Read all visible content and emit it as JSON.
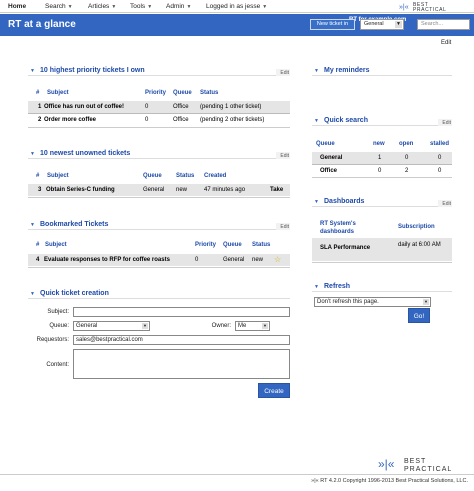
{
  "topnav": {
    "items": [
      {
        "label": "Home",
        "arrow": ""
      },
      {
        "label": "Search",
        "arrow": "▼"
      },
      {
        "label": "Articles",
        "arrow": "▼"
      },
      {
        "label": "Tools",
        "arrow": "▼"
      },
      {
        "label": "Admin",
        "arrow": "▼"
      },
      {
        "label": "Logged in as jesse",
        "arrow": "▼"
      }
    ]
  },
  "brand": {
    "name": "BEST PRACTICAL",
    "mark": "»|«"
  },
  "header": {
    "title": "RT at a glance",
    "rt_for": "RT for example.com",
    "new_ticket_label": "New ticket in",
    "queue_value": "General",
    "search_placeholder": "Search..."
  },
  "page_edit": "Edit",
  "priority_box": {
    "title": "10 highest priority tickets I own",
    "edit": "Edit",
    "columns": [
      "#",
      "Subject",
      "Priority",
      "Queue",
      "Status"
    ],
    "rows": [
      {
        "id": "1",
        "subject": "Office has run out of coffee!",
        "priority": "0",
        "queue": "Office",
        "status": "(pending 1 other ticket)"
      },
      {
        "id": "2",
        "subject": "Order more coffee",
        "priority": "0",
        "queue": "Office",
        "status": "(pending 2 other tickets)"
      }
    ]
  },
  "unowned_box": {
    "title": "10 newest unowned tickets",
    "edit": "Edit",
    "columns": [
      "#",
      "Subject",
      "Queue",
      "Status",
      "Created"
    ],
    "rows": [
      {
        "id": "3",
        "subject": "Obtain Series-C funding",
        "queue": "General",
        "status": "new",
        "created": "47 minutes ago",
        "action": "Take"
      }
    ]
  },
  "bookmarked_box": {
    "title": "Bookmarked Tickets",
    "edit": "Edit",
    "columns": [
      "#",
      "Subject",
      "Priority",
      "Queue",
      "Status"
    ],
    "rows": [
      {
        "id": "4",
        "subject": "Evaluate responses to RFP for coffee roasts",
        "priority": "0",
        "queue": "General",
        "status": "new"
      }
    ]
  },
  "quick_create": {
    "title": "Quick ticket creation",
    "subject_label": "Subject:",
    "queue_label": "Queue:",
    "queue_value": "General",
    "owner_label": "Owner:",
    "owner_value": "Me",
    "requestors_label": "Requestors:",
    "requestors_value": "sales@bestpractical.com",
    "content_label": "Content:",
    "create_label": "Create"
  },
  "reminders_box": {
    "title": "My reminders"
  },
  "quick_search": {
    "title": "Quick search",
    "edit": "Edit",
    "columns": [
      "Queue",
      "new",
      "open",
      "stalled"
    ],
    "rows": [
      {
        "queue": "General",
        "new": "1",
        "open": "0",
        "stalled": "0"
      },
      {
        "queue": "Office",
        "new": "0",
        "open": "2",
        "stalled": "0"
      }
    ]
  },
  "dashboards": {
    "title": "Dashboards",
    "edit": "Edit",
    "col1": "RT System's dashboards",
    "col2": "Subscription",
    "rows": [
      {
        "name": "SLA Performance",
        "subscription": "daily at 6:00 AM"
      }
    ]
  },
  "refresh": {
    "title": "Refresh",
    "select_value": "Don't refresh this page.",
    "go_label": "Go!"
  },
  "footer": {
    "text": "»|« RT 4.2.0 Copyright 1996-2013 Best Practical Solutions, LLC."
  },
  "colors": {
    "header": "#3266c0",
    "link": "#1e4aa8",
    "row_alt": "#e5e5e5"
  }
}
